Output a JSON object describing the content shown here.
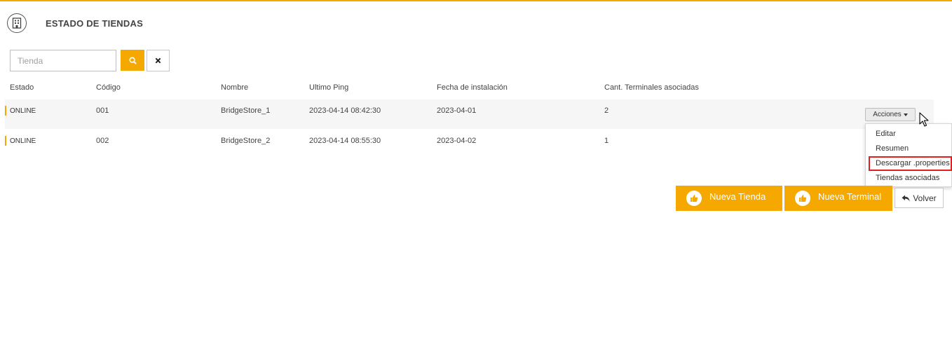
{
  "page": {
    "title": "ESTADO DE TIENDAS",
    "header_icon": "building-icon",
    "accent_color": "#f5a800"
  },
  "search": {
    "placeholder": "Tienda",
    "value": "",
    "search_icon": "search-icon",
    "clear_icon": "close-icon"
  },
  "table": {
    "columns": [
      "Estado",
      "Código",
      "Nombre",
      "Ultimo Ping",
      "Fecha de instalación",
      "Cant. Terminales asociadas"
    ],
    "rows": [
      {
        "estado": "ONLINE",
        "codigo": "001",
        "nombre": "BridgeStore_1",
        "ultimo_ping": "2023-04-14 08:42:30",
        "fecha_instalacion": "2023-04-01",
        "cant_terminales": "2"
      },
      {
        "estado": "ONLINE",
        "codigo": "002",
        "nombre": "BridgeStore_2",
        "ultimo_ping": "2023-04-14 08:55:30",
        "fecha_instalacion": "2023-04-02",
        "cant_terminales": "1"
      }
    ]
  },
  "actions_menu": {
    "button_label": "Acciones",
    "items": [
      "Editar",
      "Resumen",
      "Descargar .properties",
      "Tiendas asociadas"
    ],
    "highlighted_item": "Descargar .properties",
    "highlight_color": "#e02020"
  },
  "footer_buttons": {
    "nueva_tienda": "Nueva Tienda",
    "nueva_terminal": "Nueva Terminal",
    "volver": "Volver",
    "thumb_icon": "thumbs-up-icon",
    "back_icon": "reply-arrow-icon"
  }
}
